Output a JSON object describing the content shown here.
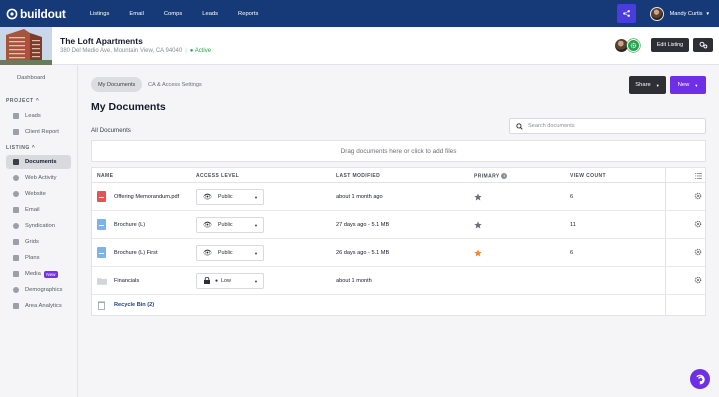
{
  "nav": {
    "logo_text": "buildout",
    "links": [
      "Listings",
      "Email",
      "Comps",
      "Leads",
      "Reports"
    ],
    "user_name": "Mandy Curtis"
  },
  "property": {
    "title": "The Loft Apartments",
    "address": "380 Del Medio Ave, Mountain View, CA 94040",
    "status": "Active",
    "edit_label": "Edit Listing"
  },
  "sidebar": {
    "dashboard": "Dashboard",
    "project_label": "PROJECT",
    "project_items": [
      "Leads",
      "Client Report"
    ],
    "listing_label": "LISTING",
    "listing_items": [
      "Documents",
      "Web Activity",
      "Website",
      "Email",
      "Syndication",
      "Grids",
      "Plans",
      "Media",
      "Demographics",
      "Area Analytics"
    ],
    "selected": "Documents",
    "new_badge": "New"
  },
  "tabs": [
    "My Documents",
    "CA & Access Settings"
  ],
  "actions": {
    "share": "Share",
    "new": "New"
  },
  "page_title": "My Documents",
  "section_title": "All Documents",
  "search": {
    "placeholder": "Search documents"
  },
  "dropzone": "Drag documents here or click to add files",
  "table": {
    "headers": [
      "NAME",
      "ACCESS LEVEL",
      "LAST MODIFIED",
      "PRIMARY",
      "VIEW COUNT"
    ],
    "rows": [
      {
        "name": "Offering Memorandum.pdf",
        "access": "Public",
        "modified": "about 1 month ago",
        "primary": false,
        "views": "6"
      },
      {
        "name": "Brochure (L)",
        "access": "Public",
        "modified": "27 days ago - 5.1 MB",
        "primary": false,
        "views": "11"
      },
      {
        "name": "Brochure (L) First",
        "access": "Public",
        "modified": "26 days ago - 5.1 MB",
        "primary": true,
        "views": "6"
      },
      {
        "name": "Financials",
        "access": "Low",
        "modified": "about 1 month",
        "primary": null,
        "views": ""
      }
    ],
    "recycle_bin": "Recycle Bin (2)"
  },
  "colors": {
    "nav_bg": "#163a77",
    "accent_purple": "#6f2fe6",
    "active_green": "#2ca24a",
    "star_orange": "#f08a24",
    "pdf_red": "#e25555",
    "doc_blue": "#7db3e8"
  }
}
